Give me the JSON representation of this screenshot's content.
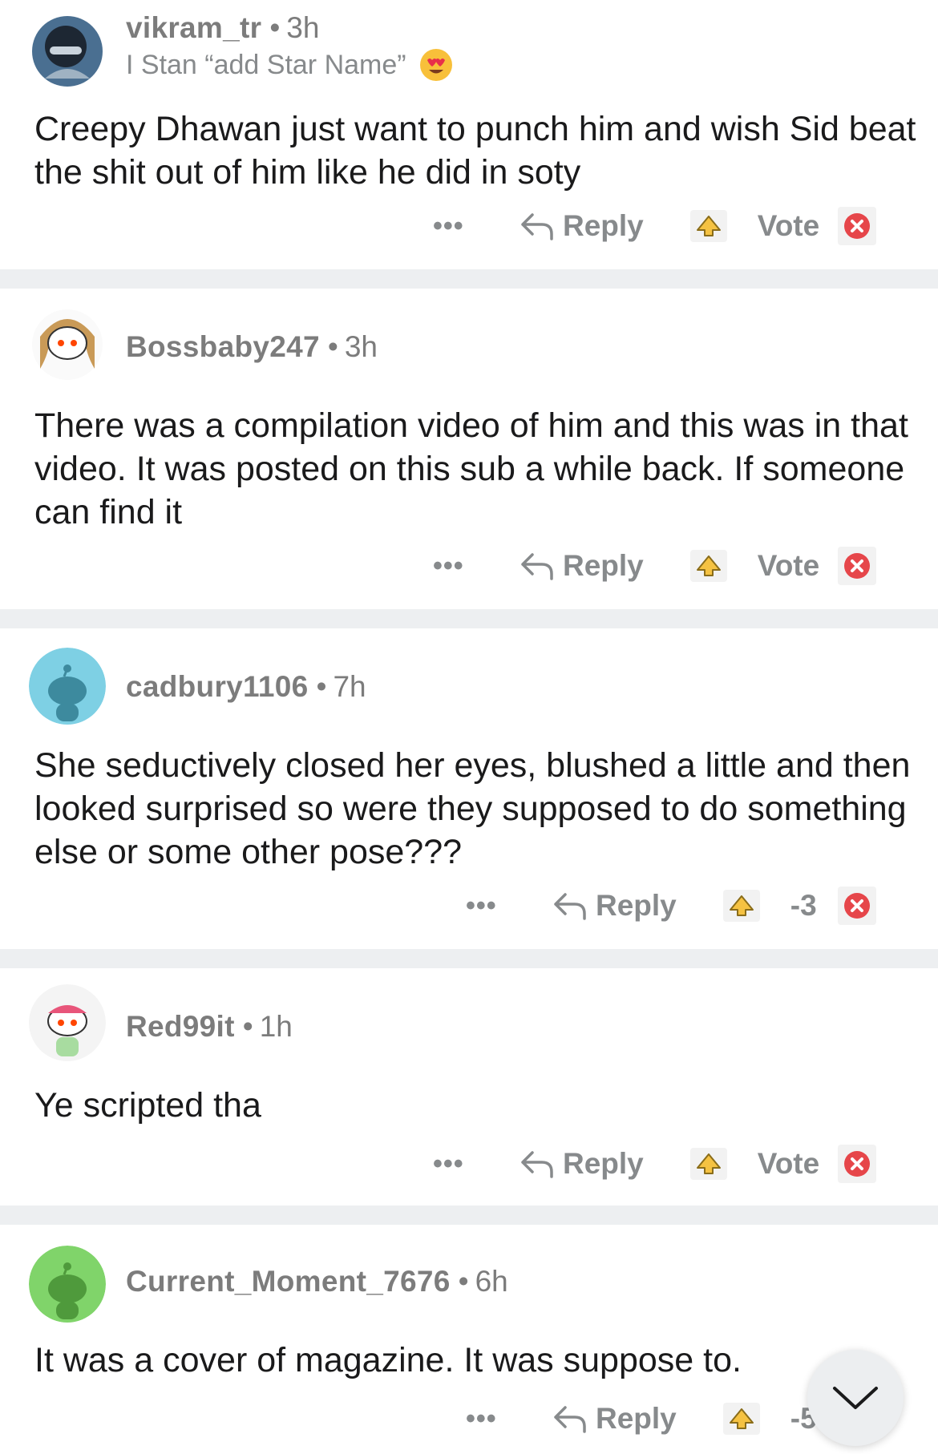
{
  "comments": [
    {
      "username": "vikram_tr",
      "time": "3h",
      "flair": "I Stan “add Star Name”",
      "body": "Creepy Dhawan just want to punch him and wish Sid beat the shit out of him like he did in soty",
      "reply_label": "Reply",
      "score": "Vote",
      "avatar_color": "#5a7fa0"
    },
    {
      "username": "Bossbaby247",
      "time": "3h",
      "body": "There was a compilation video of him and this was in that video. It was posted on this sub a while back. If someone can find it",
      "reply_label": "Reply",
      "score": "Vote",
      "avatar_color": "#ffffff"
    },
    {
      "username": "cadbury1106",
      "time": "7h",
      "body": "She seductively closed her eyes, blushed a little and then looked surprised so were they supposed to do something else or some other pose???",
      "reply_label": "Reply",
      "score": "-3",
      "avatar_color": "#7ed0e4"
    },
    {
      "username": "Red99it",
      "time": "1h",
      "body": "Ye scripted tha",
      "reply_label": "Reply",
      "score": "Vote",
      "avatar_color": "#ffffff"
    },
    {
      "username": "Current_Moment_7676",
      "time": "6h",
      "body": "It was a cover of magazine. It was suppose to.",
      "reply_label": "Reply",
      "score": "-5",
      "avatar_color": "#80d46a"
    }
  ],
  "more_glyph": "•••",
  "time_separator": "•",
  "colors": {
    "meta": "#7c7c7c",
    "action": "#878a8c",
    "separator": "#edeff1",
    "downvote": "#e6464a",
    "upvote": "#f5c242"
  },
  "icons": {
    "reply": "reply-arrow-icon",
    "upvote": "upvote-award-icon",
    "downvote": "downvote-x-icon",
    "collapse": "chevron-down-icon"
  }
}
